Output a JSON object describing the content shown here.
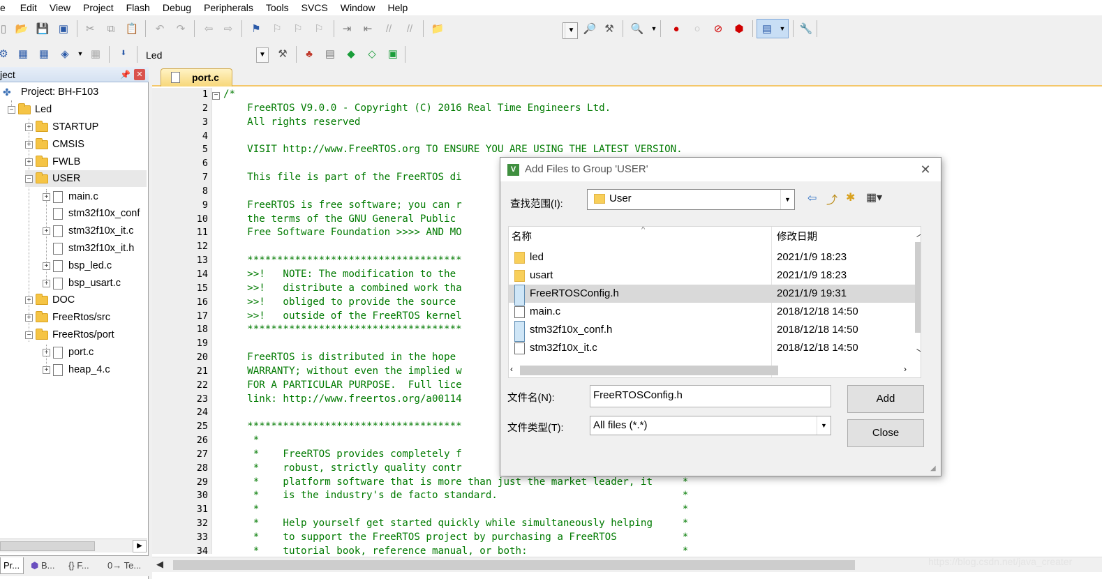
{
  "menu": [
    "e",
    "Edit",
    "View",
    "Project",
    "Flash",
    "Debug",
    "Peripherals",
    "Tools",
    "SVCS",
    "Window",
    "Help"
  ],
  "toolbar": {
    "target_combo": "Led"
  },
  "project": {
    "header": "ject",
    "root": "Project: BH-F103",
    "target": "Led",
    "items": [
      {
        "label": "STARTUP",
        "type": "folder"
      },
      {
        "label": "CMSIS",
        "type": "folder"
      },
      {
        "label": "FWLB",
        "type": "folder"
      },
      {
        "label": "USER",
        "type": "folder"
      },
      {
        "label": "main.c",
        "type": "file"
      },
      {
        "label": "stm32f10x_conf",
        "type": "file"
      },
      {
        "label": "stm32f10x_it.c",
        "type": "file"
      },
      {
        "label": "stm32f10x_it.h",
        "type": "file"
      },
      {
        "label": "bsp_led.c",
        "type": "file"
      },
      {
        "label": "bsp_usart.c",
        "type": "file"
      },
      {
        "label": "DOC",
        "type": "folder"
      },
      {
        "label": "FreeRtos/src",
        "type": "folder"
      },
      {
        "label": "FreeRtos/port",
        "type": "folder"
      },
      {
        "label": "port.c",
        "type": "file"
      },
      {
        "label": "heap_4.c",
        "type": "file"
      }
    ],
    "tabs": [
      "Pr...",
      "B...",
      "{} F...",
      "0→ Te..."
    ]
  },
  "editor": {
    "tab": "port.c",
    "line_numbers": [
      "1",
      "2",
      "3",
      "4",
      "5",
      "6",
      "7",
      "8",
      "9",
      "10",
      "11",
      "12",
      "13",
      "14",
      "15",
      "16",
      "17",
      "18",
      "19",
      "20",
      "21",
      "22",
      "23",
      "24",
      "25",
      "26",
      "27",
      "28",
      "29",
      "30",
      "31",
      "32",
      "33",
      "34"
    ],
    "lines": [
      "/*",
      "    FreeRTOS V9.0.0 - Copyright (C) 2016 Real Time Engineers Ltd.",
      "    All rights reserved",
      "",
      "    VISIT http://www.FreeRTOS.org TO ENSURE YOU ARE USING THE LATEST VERSION.",
      "",
      "    This file is part of the FreeRTOS di",
      "",
      "    FreeRTOS is free software; you can r",
      "    the terms of the GNU General Public ",
      "    Free Software Foundation >>>> AND MO",
      "",
      "    ************************************",
      "    >>!   NOTE: The modification to the ",
      "    >>!   distribute a combined work tha",
      "    >>!   obliged to provide the source ",
      "    >>!   outside of the FreeRTOS kernel",
      "    ************************************",
      "",
      "    FreeRTOS is distributed in the hope ",
      "    WARRANTY; without even the implied w",
      "    FOR A PARTICULAR PURPOSE.  Full lice",
      "    link: http://www.freertos.org/a00114",
      "",
      "    ************************************",
      "     *",
      "     *    FreeRTOS provides completely f",
      "     *    robust, strictly quality contr",
      "     *    platform software that is more than just the market leader, it     *",
      "     *    is the industry's de facto standard.                               *",
      "     *                                                                       *",
      "     *    Help yourself get started quickly while simultaneously helping     *",
      "     *    to support the FreeRTOS project by purchasing a FreeRTOS           *",
      "     *    tutorial book, reference manual, or both:                          *"
    ]
  },
  "dialog": {
    "title": "Add Files to Group 'USER'",
    "look_in_label": "查找范围(I):",
    "look_in_value": "User",
    "col_name": "名称",
    "col_date": "修改日期",
    "files": [
      {
        "name": "led",
        "date": "2021/1/9 18:23",
        "kind": "folder"
      },
      {
        "name": "usart",
        "date": "2021/1/9 18:23",
        "kind": "folder"
      },
      {
        "name": "FreeRTOSConfig.h",
        "date": "2021/1/9 19:31",
        "kind": "header"
      },
      {
        "name": "main.c",
        "date": "2018/12/18 14:50",
        "kind": "source"
      },
      {
        "name": "stm32f10x_conf.h",
        "date": "2018/12/18 14:50",
        "kind": "header"
      },
      {
        "name": "stm32f10x_it.c",
        "date": "2018/12/18 14:50",
        "kind": "source"
      }
    ],
    "filename_label": "文件名(N):",
    "filename_value": "FreeRTOSConfig.h",
    "filetype_label": "文件类型(T):",
    "filetype_value": "All files (*.*)",
    "add_button": "Add",
    "close_button": "Close"
  },
  "watermark": "https://blog.csdn.net/java_creater"
}
